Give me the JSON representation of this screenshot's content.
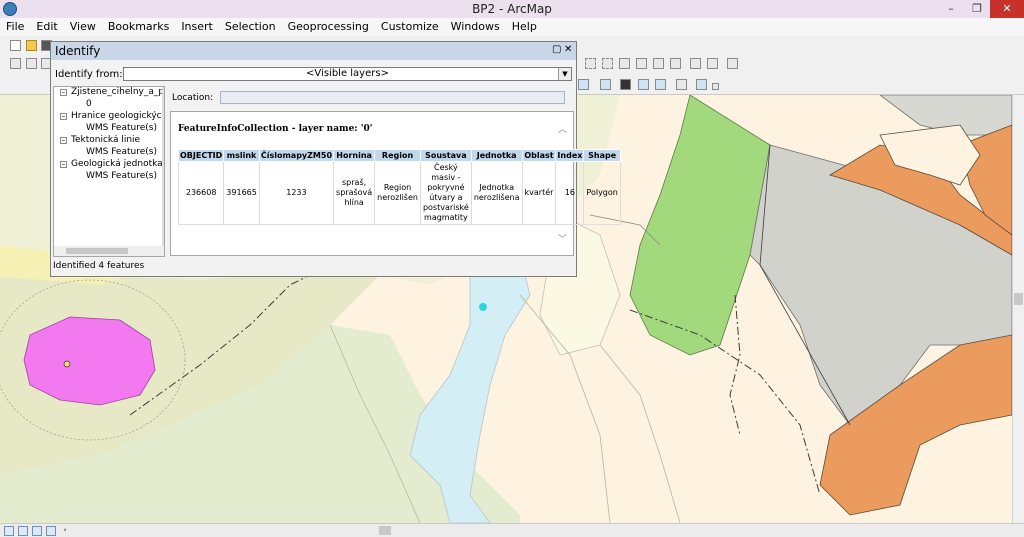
{
  "window": {
    "title": "BP2 - ArcMap",
    "minimize": "–",
    "restore": "❐",
    "close": "✕"
  },
  "menu": [
    "File",
    "Edit",
    "View",
    "Bookmarks",
    "Insert",
    "Selection",
    "Geoprocessing",
    "Customize",
    "Windows",
    "Help"
  ],
  "identify": {
    "title": "Identify",
    "from_label": "Identify from:",
    "from_value": "<Visible layers>",
    "location_label": "Location:",
    "location_value": "",
    "tree": [
      {
        "label": "Zjistene_cihelny_a_pisk",
        "child": "0"
      },
      {
        "label": "Hranice geologických je",
        "child": "WMS Feature(s)"
      },
      {
        "label": "Tektonická linie",
        "child": "WMS Feature(s)"
      },
      {
        "label": "Geologická jednotka",
        "child": "WMS Feature(s)"
      }
    ],
    "heading": "FeatureInfoCollection - layer name: '0'",
    "columns": [
      "OBJECTID",
      "mslink",
      "ČíslomapyZM50",
      "Hornina",
      "Region",
      "Soustava",
      "Jednotka",
      "Oblast",
      "Index",
      "Shape"
    ],
    "row": [
      "236608",
      "391665",
      "1233",
      "spraš, sprašová hlína",
      "Region nerozlišen",
      "Český masiv - pokryvné útvary a postvariské magmatity",
      "Jednotka nerozlišena",
      "kvartér",
      "16",
      "Polygon"
    ],
    "status": "Identified 4 features"
  },
  "colors": {
    "map_background": "#e7ead3",
    "pink_feature": "#f279f0",
    "green_feature": "#a3d97d",
    "orange_feature": "#ec9b5e",
    "grey_feature": "#d2d2cd",
    "water_feature": "#d4eef6",
    "point_marker": "#29d6dc"
  }
}
